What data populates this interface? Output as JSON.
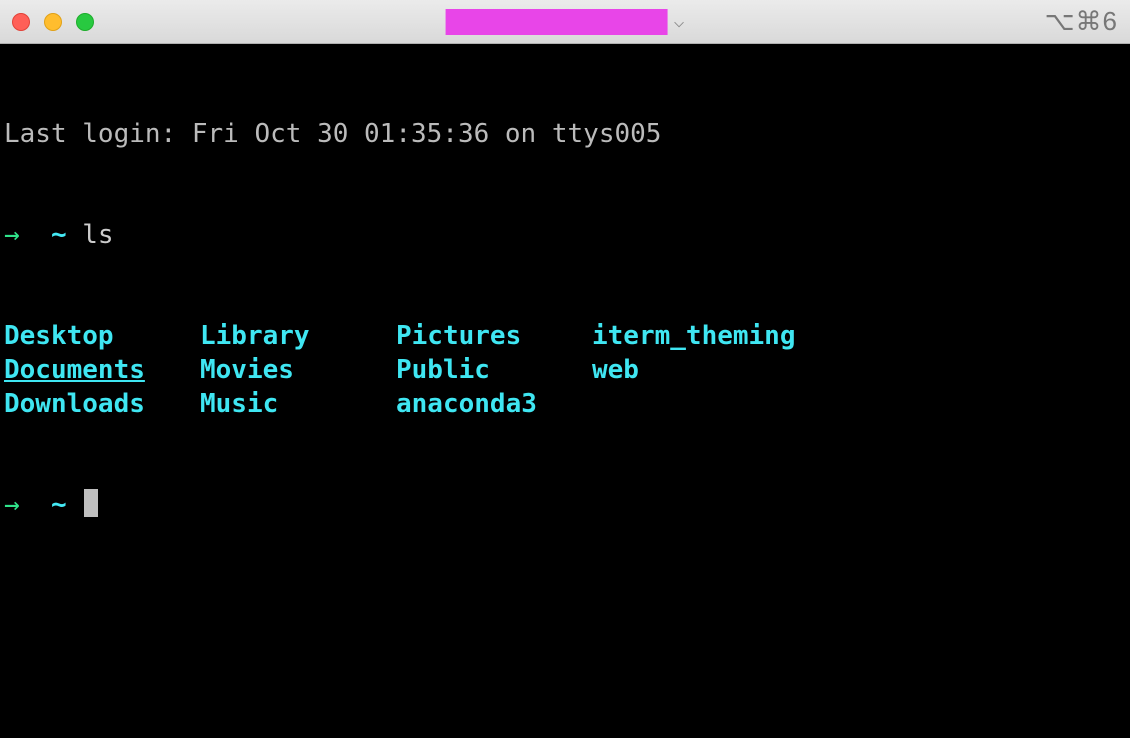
{
  "titlebar": {
    "shortcut": "⌥⌘6"
  },
  "terminal": {
    "last_login": "Last login: Fri Oct 30 01:35:36 on ttys005",
    "prompt1": {
      "arrow": "→",
      "tilde": "~",
      "command": "ls"
    },
    "ls_output": {
      "col1": [
        "Desktop",
        "Documents",
        "Downloads"
      ],
      "col2": [
        "Library",
        "Movies",
        "Music"
      ],
      "col3": [
        "Pictures",
        "Public",
        "anaconda3"
      ],
      "col4": [
        "iterm_theming",
        "web",
        ""
      ]
    },
    "prompt2": {
      "arrow": "→",
      "tilde": "~"
    }
  }
}
